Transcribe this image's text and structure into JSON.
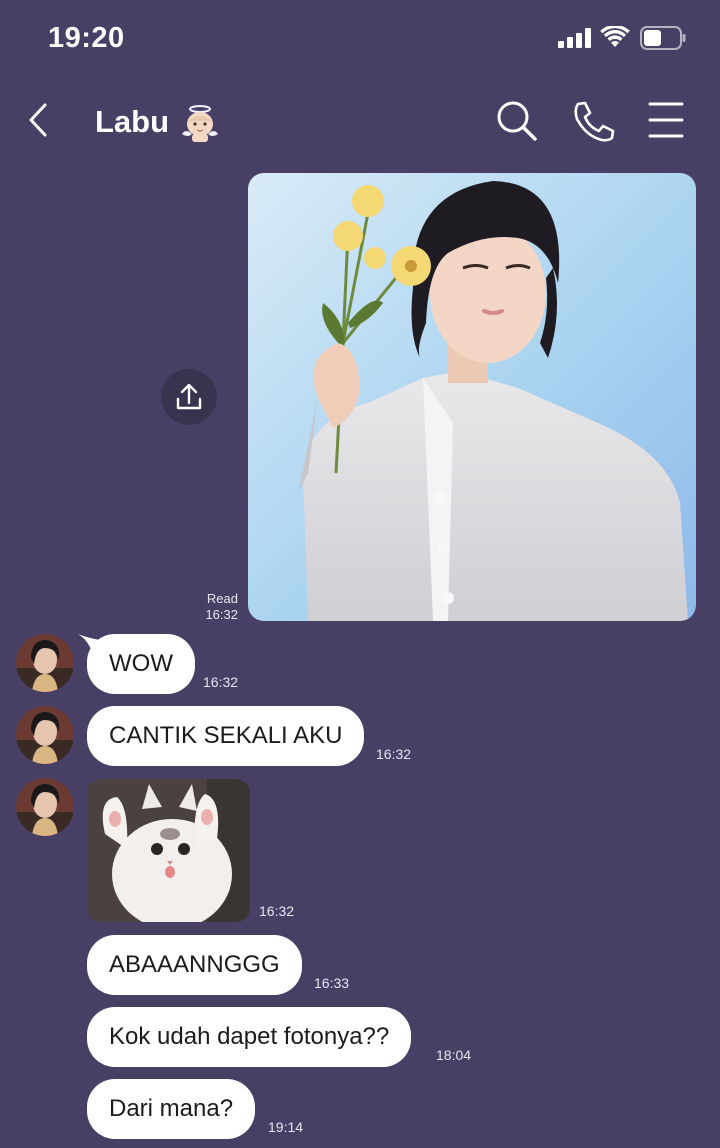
{
  "colors": {
    "background": "#483f65",
    "bubble": "#ffffff",
    "bubble_text": "#1b1b1b"
  },
  "status_bar": {
    "time": "19:20",
    "icons": [
      "cellular-signal-icon",
      "wifi-icon",
      "battery-icon"
    ]
  },
  "header": {
    "title": "Labu",
    "title_emoji_icon": "angel-baby-emoji-icon",
    "icons": [
      "back-chevron-icon",
      "search-icon",
      "phone-call-icon",
      "hamburger-menu-icon"
    ]
  },
  "messages": {
    "sent_photo": {
      "read_label": "Read",
      "time": "16:32"
    },
    "received": [
      {
        "text": "WOW",
        "time": "16:32"
      },
      {
        "text": "CANTIK SEKALI AKU",
        "time": "16:32"
      },
      {
        "type": "image",
        "time": "16:32"
      },
      {
        "text": "ABAAANNGGG",
        "time": "16:33"
      },
      {
        "text": "Kok udah dapet fotonya??",
        "time": "18:04"
      },
      {
        "text": "Dari mana?",
        "time": "19:14"
      }
    ]
  }
}
